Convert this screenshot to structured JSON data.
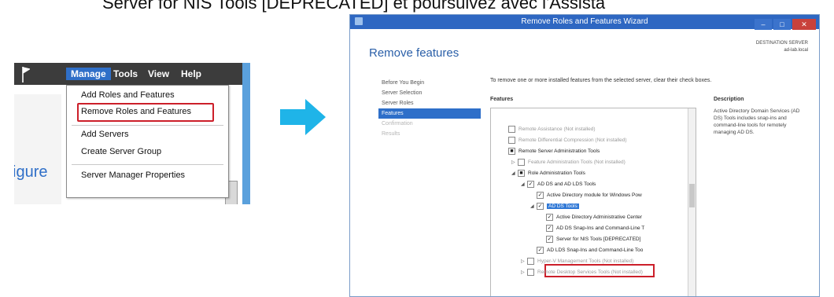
{
  "caption": "Server for NIS Tools [DEPRECATED] et poursuivez avec l'Assista",
  "server_manager": {
    "menu": [
      "Manage",
      "Tools",
      "View",
      "Help"
    ],
    "dropdown": [
      "Add Roles and Features",
      "Remove Roles and Features",
      "Add Servers",
      "Create Server Group",
      "Server Manager Properties"
    ],
    "partial_text": "igure"
  },
  "wizard": {
    "title": "Remove Roles and Features Wizard",
    "heading": "Remove features",
    "destination_label": "DESTINATION SERVER",
    "destination_value": "ad-lab.local",
    "nav": [
      "Before You Begin",
      "Server Selection",
      "Server Roles",
      "Features",
      "Confirmation",
      "Results"
    ],
    "instruction": "To remove one or more installed features from the selected server, clear their check boxes.",
    "features_label": "Features",
    "description_label": "Description",
    "description": "Active Directory Domain Services (AD DS) Tools includes snap-ins and command-line tools for remotely managing AD DS.",
    "tree": [
      {
        "text": "Remote Assistance (Not installed)",
        "level": 0,
        "checked": "",
        "expander": "",
        "grey": true
      },
      {
        "text": "Remote Differential Compression (Not installed)",
        "level": 0,
        "checked": "",
        "expander": "",
        "grey": true
      },
      {
        "text": "Remote Server Administration Tools",
        "level": 0,
        "checked": "■",
        "expander": "",
        "grey": false
      },
      {
        "text": "Feature Administration Tools (Not installed)",
        "level": 1,
        "checked": "",
        "expander": "▷",
        "grey": true
      },
      {
        "text": "Role Administration Tools",
        "level": 1,
        "checked": "■",
        "expander": "◢",
        "grey": false
      },
      {
        "text": "AD DS and AD LDS Tools",
        "level": 2,
        "checked": "✓",
        "expander": "◢",
        "grey": false
      },
      {
        "text": "Active Directory module for Windows Pow",
        "level": 3,
        "checked": "✓",
        "expander": "",
        "grey": false
      },
      {
        "text": "AD DS Tools",
        "level": 3,
        "checked": "✓",
        "expander": "◢",
        "grey": false
      },
      {
        "text": "Active Directory Administrative Center",
        "level": 4,
        "checked": "✓",
        "expander": "",
        "grey": false
      },
      {
        "text": "AD DS Snap-Ins and Command-Line T",
        "level": 4,
        "checked": "✓",
        "expander": "",
        "grey": false
      },
      {
        "text": "Server for NIS Tools [DEPRECATED]",
        "level": 4,
        "checked": "✓",
        "expander": "",
        "grey": false
      },
      {
        "text": "AD LDS Snap-Ins and Command-Line Too",
        "level": 3,
        "checked": "✓",
        "expander": "",
        "grey": false
      },
      {
        "text": "Hyper-V Management Tools (Not installed)",
        "level": 2,
        "checked": "",
        "expander": "▷",
        "grey": true
      },
      {
        "text": "Remote Desktop Services Tools (Not installed)",
        "level": 2,
        "checked": "",
        "expander": "▷",
        "grey": true
      }
    ]
  },
  "colors": {
    "accent": "#2e6fc9",
    "highlight_box": "#cc1f2a",
    "arrow": "#1fb4e8"
  }
}
